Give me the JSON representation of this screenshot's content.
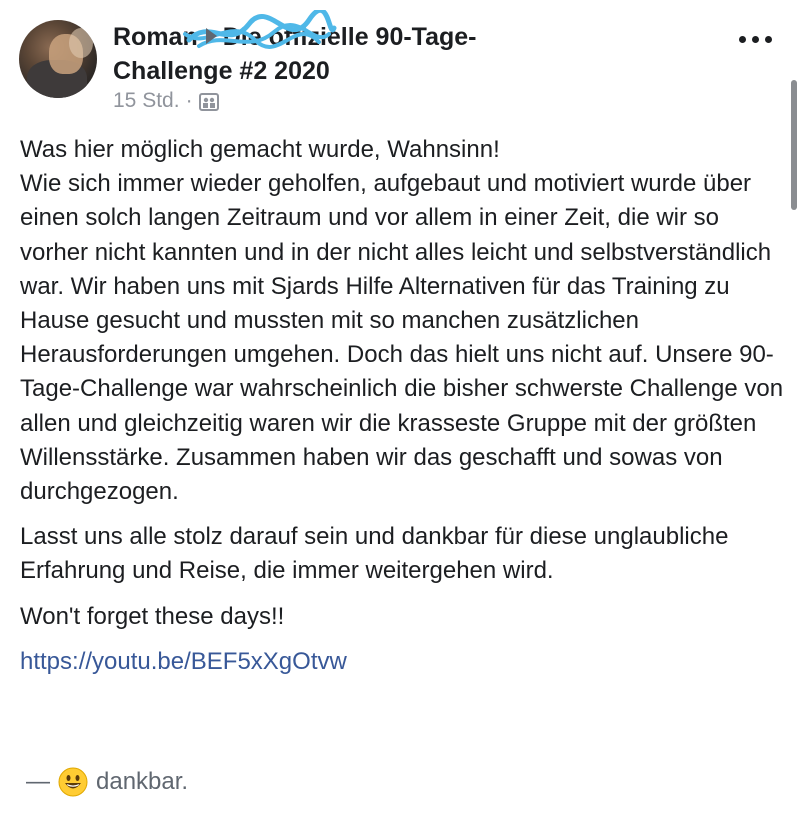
{
  "post": {
    "author": "Roman",
    "group_name_line1": "Die offizielle 90-Tage-",
    "group_name_line2": "Challenge #2 2020",
    "time": "15 Std.",
    "dot": "·",
    "privacy_icon": "group-privacy-icon",
    "more_icon": "more-options-icon",
    "paragraphs": [
      "Was hier möglich gemacht wurde, Wahnsinn!",
      "Wie sich immer wieder geholfen, aufgebaut und motiviert wurde über einen solch langen Zeitraum und vor allem in einer Zeit, die wir so vorher nicht kannten und in der nicht alles leicht und selbstverständlich war. Wir haben uns mit Sjards Hilfe Alternativen für das Training zu Hause gesucht und mussten mit so manchen zusätzlichen Herausforderungen umgehen. Doch das hielt uns nicht auf. Unsere 90-Tage-Challenge war wahrscheinlich die bisher schwerste Challenge von allen und gleichzeitig waren wir die krasseste Gruppe mit der größten Willensstärke. Zusammen haben wir das geschafft und sowas von durchgezogen.",
      "Lasst uns alle stolz darauf sein und dankbar für diese unglaubliche Erfahrung und Reise, die immer weitergehen wird.",
      "Won't forget these days!!"
    ],
    "link": "https://youtu.be/BEF5xXgOtvw",
    "feeling_dash": "—",
    "feeling_emoji": "grinning-face-emoji",
    "feeling_text": "dankbar."
  },
  "colors": {
    "text": "#1c1e21",
    "meta": "#90949c",
    "link": "#385898",
    "scribble": "#4fb8e8"
  }
}
